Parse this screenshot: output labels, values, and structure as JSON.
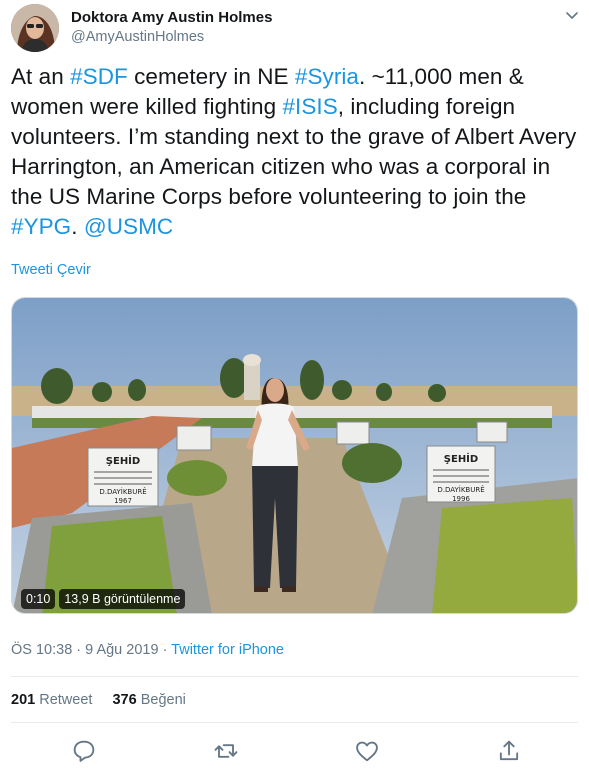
{
  "header": {
    "display_name": "Doktora Amy Austin Holmes",
    "handle": "@AmyAustinHolmes"
  },
  "tweet": {
    "segments": [
      {
        "text": "At an ",
        "type": "text"
      },
      {
        "text": "#SDF",
        "type": "hashtag"
      },
      {
        "text": " cemetery in NE ",
        "type": "text"
      },
      {
        "text": "#Syria",
        "type": "hashtag"
      },
      {
        "text": ". ~11,000 men & women were killed fighting ",
        "type": "text"
      },
      {
        "text": "#ISIS",
        "type": "hashtag"
      },
      {
        "text": ", including foreign volunteers. I’m standing next to the grave of Albert Avery Harrington, an American citizen who was a corporal in the US Marine Corps before volunteering to join the ",
        "type": "text"
      },
      {
        "text": "#YPG",
        "type": "hashtag"
      },
      {
        "text": ". ",
        "type": "text"
      },
      {
        "text": "@USMC",
        "type": "mention"
      }
    ],
    "translate_label": "Tweeti Çevir"
  },
  "media": {
    "time": "0:10",
    "views": "13,9 B görüntülenme",
    "grave_label_left": "ŞEHİD",
    "grave_name_left": "D.DAYİKBURÊ",
    "grave_year_left": "1967",
    "grave_label_right": "ŞEHİD",
    "grave_name_right": "D.DAYİKBURÊ",
    "grave_year_right": "1996"
  },
  "meta": {
    "time": "ÖS 10:38",
    "separator": " · ",
    "date": "9 Ağu 2019",
    "source": "Twitter for iPhone"
  },
  "stats": {
    "retweets": "201",
    "retweets_label": "Retweet",
    "likes": "376",
    "likes_label": "Beğeni"
  },
  "colors": {
    "link": "#1b95e0",
    "secondary": "#657786",
    "primary_text": "#14171a"
  }
}
